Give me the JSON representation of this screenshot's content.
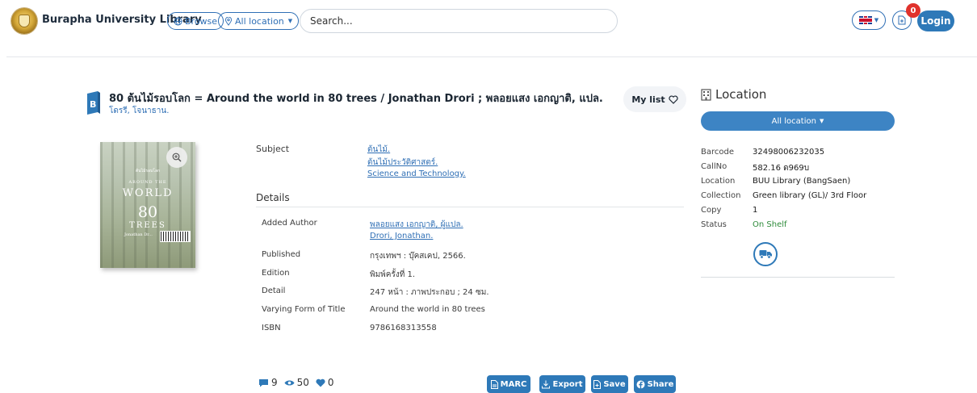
{
  "header": {
    "brand": "Burapha University Library",
    "browse_label": "Browse",
    "location_label": "All location",
    "search_placeholder": "Search...",
    "cart_count": "0",
    "login_label": "Login"
  },
  "record": {
    "title": "80 ต้นไม้รอบโลก = Around the world in 80 trees / Jonathan Drori ; พลอยแสง เอกญาติ, แปล.",
    "author": "โดรรี, โจนาธาน.",
    "mylist_label": "My list",
    "cover": {
      "small_top": "ต้นไม้รอบโลก",
      "around": "AROUND THE",
      "world": "WORLD",
      "number": "80",
      "trees": "TREES",
      "author": "Jonathan Dr..."
    },
    "subject_label": "Subject",
    "subjects": [
      "ต้นไม้.",
      "ต้นไม้ประวัติศาสตร์.",
      "Science and Technology."
    ],
    "details_label": "Details",
    "details": {
      "added_author_label": "Added Author",
      "added_authors": [
        "พลอยแสง เอกญาติ, ผู้แปล.",
        "Drori, Jonathan."
      ],
      "published_label": "Published",
      "published": "กรุงเทพฯ : บุ๊คสเคป, 2566.",
      "edition_label": "Edition",
      "edition": "พิมพ์ครั้งที่ 1.",
      "detail_label": "Detail",
      "detail": "247 หน้า : ภาพประกอบ ; 24 ซม.",
      "varying_label": "Varying Form of Title",
      "varying": "Around the world in 80 trees",
      "isbn_label": "ISBN",
      "isbn": "9786168313558"
    },
    "stats": {
      "comments": "9",
      "views": "50",
      "likes": "0"
    },
    "actions": {
      "marc": "MARC",
      "export": "Export",
      "save": "Save",
      "share": "Share"
    }
  },
  "location": {
    "title": "Location",
    "dropdown": "All location",
    "barcode_label": "Barcode",
    "barcode": "32498006232035",
    "callno_label": "CallNo",
    "callno": "582.16 ด969บ",
    "location_label": "Location",
    "location": "BUU Library (BangSaen)",
    "collection_label": "Collection",
    "collection": "Green library (GL)/ 3rd Floor",
    "copy_label": "Copy",
    "copy": "1",
    "status_label": "Status",
    "status": "On Shelf",
    "status_color": "#2e8b3a"
  },
  "colors": {
    "accent": "#2e79b8",
    "badge": "#e0322c"
  }
}
